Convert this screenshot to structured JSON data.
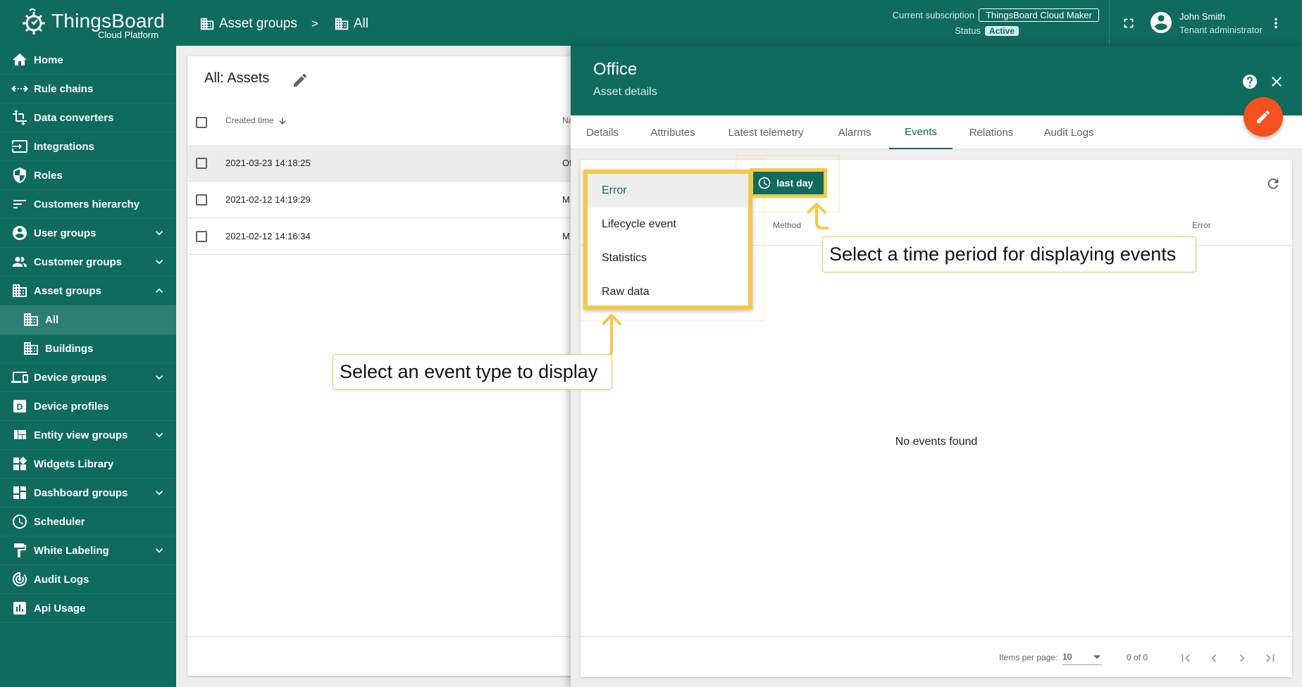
{
  "header": {
    "logo_name": "ThingsBoard",
    "logo_sub": "Cloud Platform",
    "breadcrumb": [
      "Asset groups",
      "All"
    ],
    "breadcrumb_sep": ">",
    "subscription_label": "Current subscription",
    "subscription_plan": "ThingsBoard Cloud Maker",
    "status_label": "Status",
    "status_value": "Active",
    "user_name": "John Smith",
    "user_role": "Tenant administrator"
  },
  "sidebar": {
    "items": [
      {
        "label": "Home",
        "icon": "home-icon"
      },
      {
        "label": "Rule chains",
        "icon": "rule-chain-icon"
      },
      {
        "label": "Data converters",
        "icon": "transform-icon"
      },
      {
        "label": "Integrations",
        "icon": "input-icon"
      },
      {
        "label": "Roles",
        "icon": "shield-icon"
      },
      {
        "label": "Customers hierarchy",
        "icon": "sort-icon"
      },
      {
        "label": "User groups",
        "icon": "account-circle-icon"
      },
      {
        "label": "Customer groups",
        "icon": "supervisor-icon"
      },
      {
        "label": "Asset groups",
        "icon": "domain-icon"
      },
      {
        "label": "All",
        "icon": "domain-icon"
      },
      {
        "label": "Buildings",
        "icon": "domain-icon"
      },
      {
        "label": "Device groups",
        "icon": "devices-icon"
      },
      {
        "label": "Device profiles",
        "icon": "device-profile-icon"
      },
      {
        "label": "Entity view groups",
        "icon": "view-quilt-icon"
      },
      {
        "label": "Widgets Library",
        "icon": "widgets-icon"
      },
      {
        "label": "Dashboard groups",
        "icon": "dashboard-icon"
      },
      {
        "label": "Scheduler",
        "icon": "schedule-icon"
      },
      {
        "label": "White Labeling",
        "icon": "format-paint-icon"
      },
      {
        "label": "Audit Logs",
        "icon": "track-changes-icon"
      },
      {
        "label": "Api Usage",
        "icon": "insert-chart-icon"
      }
    ]
  },
  "assets": {
    "title": "All: Assets",
    "col_created": "Created time",
    "col_name": "Na",
    "rows": [
      {
        "created": "2021-03-23 14:18:25",
        "name": "Of"
      },
      {
        "created": "2021-02-12 14:19:29",
        "name": "M"
      },
      {
        "created": "2021-02-12 14:16:34",
        "name": "M"
      }
    ]
  },
  "details": {
    "title": "Office",
    "subtitle": "Asset details",
    "tabs": [
      "Details",
      "Attributes",
      "Latest telemetry",
      "Alarms",
      "Events",
      "Relations",
      "Audit Logs"
    ],
    "active_tab": "Events",
    "time_button": "last day",
    "col_method": "Method",
    "col_error": "Error",
    "empty_text": "No events found",
    "items_per_page_label": "Items per page:",
    "items_per_page": "10",
    "range": "0 of 0"
  },
  "event_menu": {
    "items": [
      "Error",
      "Lifecycle event",
      "Statistics",
      "Raw data"
    ],
    "selected": "Error"
  },
  "callouts": {
    "event_type": "Select an event type to display",
    "time_period": "Select a time period for displaying events"
  },
  "colors": {
    "primary": "#0f6b5d",
    "accent": "#f4511e",
    "highlight": "#f3c84b"
  }
}
